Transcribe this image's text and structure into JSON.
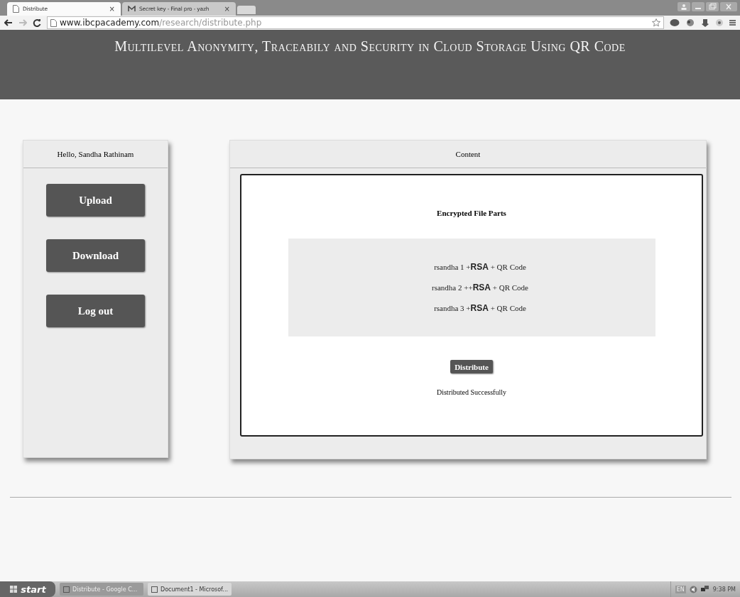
{
  "browser": {
    "tabs": [
      {
        "title": "Distribute",
        "close": "×",
        "selected": true
      },
      {
        "title": "Secret key - Final pro - yazh",
        "close": "×",
        "selected": false
      }
    ],
    "url_host": "www.ibcpacademy.com",
    "url_path": "/research/distribute.php"
  },
  "header": {
    "title": "Multilevel Anonymity, Traceabily and Security in Cloud Storage Using QR Code"
  },
  "sidebar": {
    "greeting": "Hello,  Sandha Rathinam",
    "buttons": [
      "Upload",
      "Download",
      "Log out"
    ]
  },
  "content": {
    "heading": "Content",
    "section_title": "Encrypted File Parts",
    "parts": [
      "rsandha 1 +**RSA**  + QR Code",
      "rsandha 2 ++**RSA**  + QR Code",
      "rsandha 3 +**RSA**  + QR Code"
    ],
    "button": "Distribute",
    "message": "Distributed Successfully"
  },
  "taskbar": {
    "start": "start",
    "tasks": [
      {
        "label": "Distribute - Google C...",
        "selected": true
      },
      {
        "label": "Document1 - Microsof...",
        "selected": false
      }
    ],
    "language": "EN",
    "clock": "9:38 PM"
  }
}
